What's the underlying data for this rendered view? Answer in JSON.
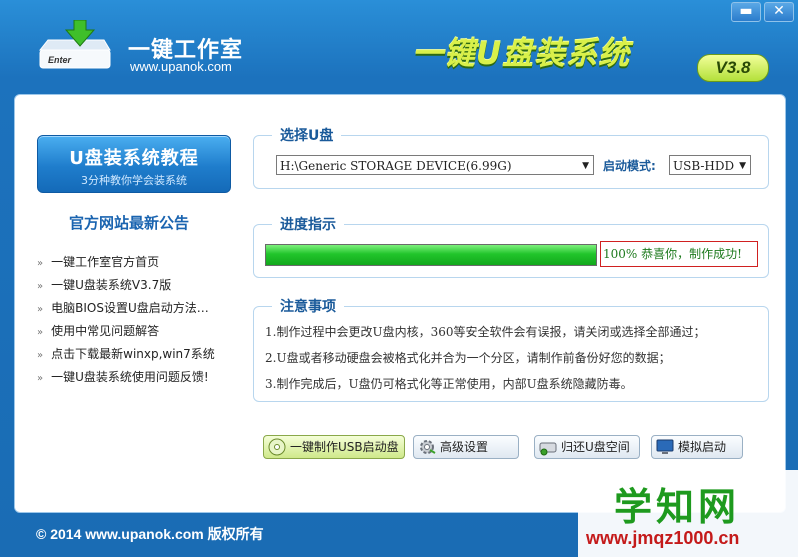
{
  "header": {
    "brand_title": "一键工作室",
    "brand_url": "www.upanok.com",
    "app_title": "一键U盘装系统",
    "version": "V3.8",
    "minimize_label": "▬",
    "close_label": "✕",
    "logo_enter_label": "Enter"
  },
  "sidebar": {
    "tutorial_title": "U盘装系统教程",
    "tutorial_subtitle": "3分种教你学会装系统",
    "notice_title": "官方网站最新公告",
    "items": [
      {
        "label": "一键工作室官方首页"
      },
      {
        "label": "一键U盘装系统V3.7版"
      },
      {
        "label": "电脑BIOS设置U盘启动方法…"
      },
      {
        "label": "使用中常见问题解答"
      },
      {
        "label": "点击下载最新winxp,win7系统"
      },
      {
        "label": "一键U盘装系统使用问题反馈!"
      }
    ]
  },
  "select_disk": {
    "legend": "选择U盘",
    "disk_value": "H:\\Generic STORAGE DEVICE(6.99G)",
    "mode_label": "启动模式:",
    "mode_value": "USB-HDD"
  },
  "progress": {
    "legend": "进度指示",
    "percent": 100,
    "status_text": "100%  恭喜你，制作成功!"
  },
  "notes": {
    "legend": "注意事项",
    "items": [
      "1.制作过程中会更改U盘内核，360等安全软件会有误报，请关闭或选择全部通过；",
      "2.U盘或者移动硬盘会被格式化并合为一个分区，请制作前备份好您的数据；",
      "3.制作完成后，U盘仍可格式化等正常使用，内部U盘系统隐藏防毒。"
    ]
  },
  "actions": {
    "make_usb": "一键制作USB启动盘",
    "advanced": "高级设置",
    "restore": "归还U盘空间",
    "simulate": "模拟启动"
  },
  "footer": {
    "copyright": "© 2014 www.upanok.com  版权所有"
  },
  "watermark": {
    "big": "学知网",
    "small": "www.jmqz1000.cn"
  },
  "colors": {
    "accent_blue": "#1a6cb4",
    "progress_green": "#21c52b",
    "title_yellow_green": "#d9f04a",
    "status_border_red": "#d02020"
  }
}
